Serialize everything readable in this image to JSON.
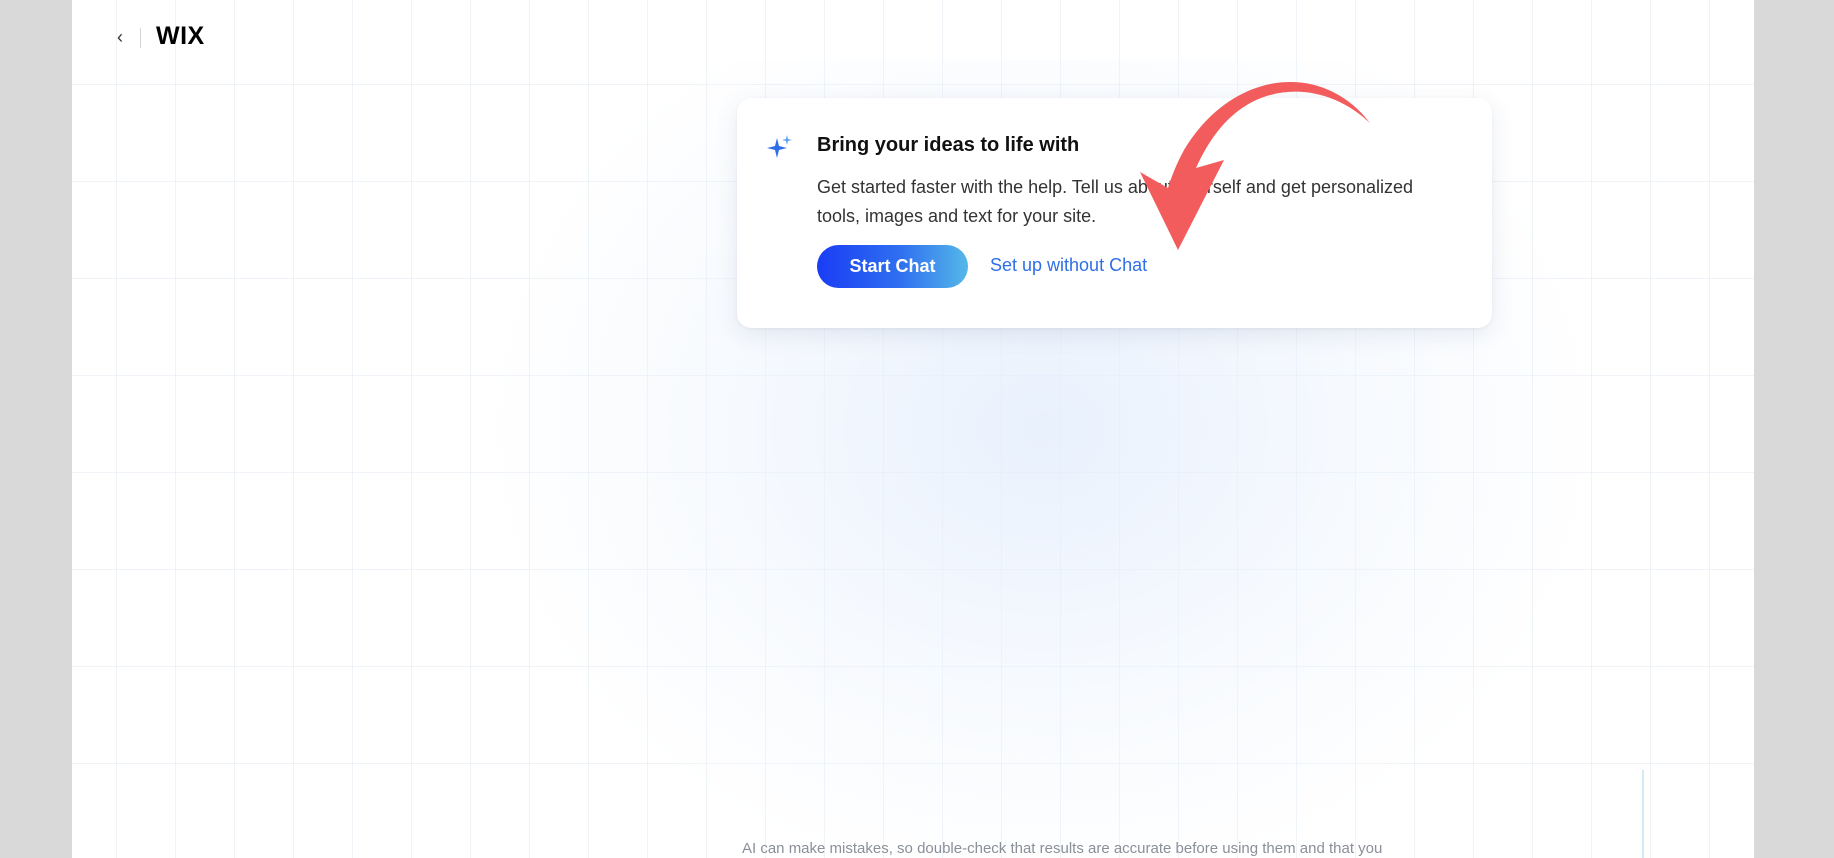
{
  "header": {
    "back_icon": "chevron-left-icon",
    "back_glyph": "‹",
    "logo_text": "WIX"
  },
  "card": {
    "icon": "sparkle-icon",
    "title": "Bring your ideas to life with",
    "description": "Get started faster with the help. Tell us about yourself and get personalized tools, images and text for your site.",
    "primary_button": "Start Chat",
    "secondary_link": "Set up without Chat"
  },
  "footer": {
    "disclaimer": "AI can make mistakes, so double-check that results are accurate before using them and that you"
  },
  "annotation": {
    "icon": "curved-arrow-icon",
    "color": "#f25c5c"
  },
  "colors": {
    "accent": "#2f6fe6",
    "button_start": "#1a3df5",
    "button_end": "#55b8e8"
  }
}
